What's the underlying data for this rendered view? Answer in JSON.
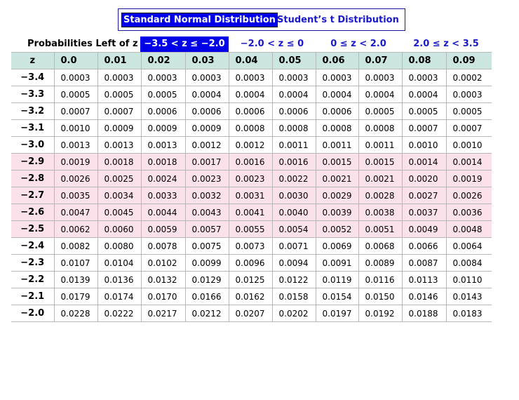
{
  "distribution_tabs": {
    "standard_normal": "Standard Normal Distribution",
    "students_t": "Student’s t Distribution"
  },
  "range_bar": {
    "label": "Probabilities Left of z",
    "tabs": [
      "−3.5 < z ≤ −2.0",
      "−2.0 < z ≤ 0",
      "0 ≤ z < 2.0",
      "2.0 ≤ z < 3.5"
    ],
    "active_index": 0
  },
  "colors": {
    "active_tab": "#0000e8",
    "header_bg": "#cbe6e1",
    "highlight_row": "#fbe1ea",
    "link_text": "#1a1acc"
  },
  "table": {
    "z_header": "z",
    "columns": [
      "0.0",
      "0.01",
      "0.02",
      "0.03",
      "0.04",
      "0.05",
      "0.06",
      "0.07",
      "0.08",
      "0.09"
    ],
    "rows": [
      {
        "z": "−3.4",
        "values": [
          "0.0003",
          "0.0003",
          "0.0003",
          "0.0003",
          "0.0003",
          "0.0003",
          "0.0003",
          "0.0003",
          "0.0003",
          "0.0002"
        ]
      },
      {
        "z": "−3.3",
        "values": [
          "0.0005",
          "0.0005",
          "0.0005",
          "0.0004",
          "0.0004",
          "0.0004",
          "0.0004",
          "0.0004",
          "0.0004",
          "0.0003"
        ]
      },
      {
        "z": "−3.2",
        "values": [
          "0.0007",
          "0.0007",
          "0.0006",
          "0.0006",
          "0.0006",
          "0.0006",
          "0.0006",
          "0.0005",
          "0.0005",
          "0.0005"
        ]
      },
      {
        "z": "−3.1",
        "values": [
          "0.0010",
          "0.0009",
          "0.0009",
          "0.0009",
          "0.0008",
          "0.0008",
          "0.0008",
          "0.0008",
          "0.0007",
          "0.0007"
        ]
      },
      {
        "z": "−3.0",
        "values": [
          "0.0013",
          "0.0013",
          "0.0013",
          "0.0012",
          "0.0012",
          "0.0011",
          "0.0011",
          "0.0011",
          "0.0010",
          "0.0010"
        ]
      },
      {
        "z": "−2.9",
        "values": [
          "0.0019",
          "0.0018",
          "0.0018",
          "0.0017",
          "0.0016",
          "0.0016",
          "0.0015",
          "0.0015",
          "0.0014",
          "0.0014"
        ]
      },
      {
        "z": "−2.8",
        "values": [
          "0.0026",
          "0.0025",
          "0.0024",
          "0.0023",
          "0.0023",
          "0.0022",
          "0.0021",
          "0.0021",
          "0.0020",
          "0.0019"
        ]
      },
      {
        "z": "−2.7",
        "values": [
          "0.0035",
          "0.0034",
          "0.0033",
          "0.0032",
          "0.0031",
          "0.0030",
          "0.0029",
          "0.0028",
          "0.0027",
          "0.0026"
        ]
      },
      {
        "z": "−2.6",
        "values": [
          "0.0047",
          "0.0045",
          "0.0044",
          "0.0043",
          "0.0041",
          "0.0040",
          "0.0039",
          "0.0038",
          "0.0037",
          "0.0036"
        ]
      },
      {
        "z": "−2.5",
        "values": [
          "0.0062",
          "0.0060",
          "0.0059",
          "0.0057",
          "0.0055",
          "0.0054",
          "0.0052",
          "0.0051",
          "0.0049",
          "0.0048"
        ]
      },
      {
        "z": "−2.4",
        "values": [
          "0.0082",
          "0.0080",
          "0.0078",
          "0.0075",
          "0.0073",
          "0.0071",
          "0.0069",
          "0.0068",
          "0.0066",
          "0.0064"
        ]
      },
      {
        "z": "−2.3",
        "values": [
          "0.0107",
          "0.0104",
          "0.0102",
          "0.0099",
          "0.0096",
          "0.0094",
          "0.0091",
          "0.0089",
          "0.0087",
          "0.0084"
        ]
      },
      {
        "z": "−2.2",
        "values": [
          "0.0139",
          "0.0136",
          "0.0132",
          "0.0129",
          "0.0125",
          "0.0122",
          "0.0119",
          "0.0116",
          "0.0113",
          "0.0110"
        ]
      },
      {
        "z": "−2.1",
        "values": [
          "0.0179",
          "0.0174",
          "0.0170",
          "0.0166",
          "0.0162",
          "0.0158",
          "0.0154",
          "0.0150",
          "0.0146",
          "0.0143"
        ]
      },
      {
        "z": "−2.0",
        "values": [
          "0.0228",
          "0.0222",
          "0.0217",
          "0.0212",
          "0.0207",
          "0.0202",
          "0.0197",
          "0.0192",
          "0.0188",
          "0.0183"
        ]
      }
    ],
    "highlighted_rows": [
      5,
      6,
      7,
      8,
      9
    ]
  }
}
